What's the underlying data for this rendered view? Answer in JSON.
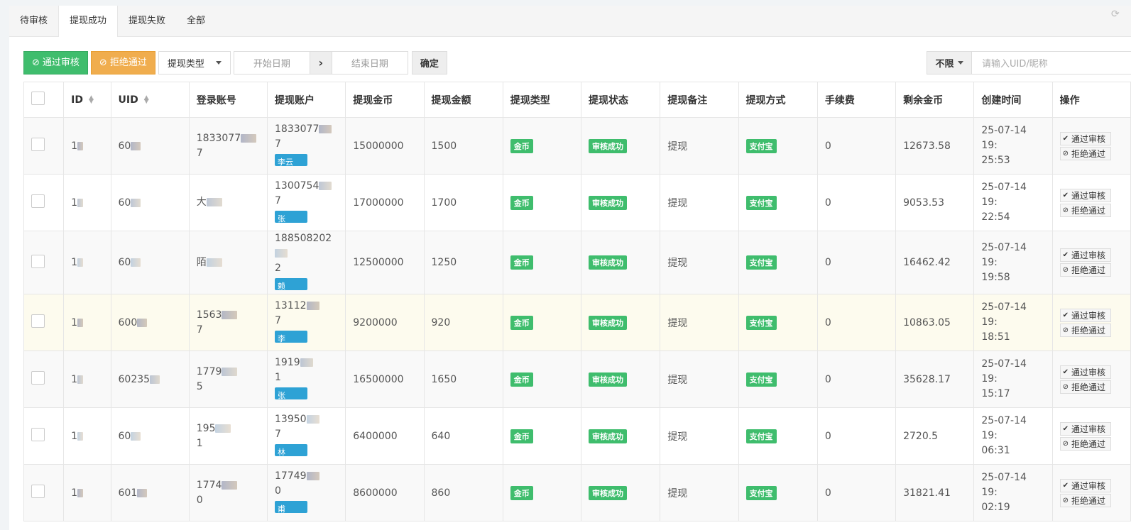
{
  "tabs": [
    {
      "label": "待审核",
      "active": false
    },
    {
      "label": "提现成功",
      "active": true
    },
    {
      "label": "提现失败",
      "active": false
    },
    {
      "label": "全部",
      "active": false
    }
  ],
  "toolbar": {
    "approve_label": "通过审核",
    "reject_label": "拒绝通过",
    "type_select": "提现类型",
    "start_date_placeholder": "开始日期",
    "end_date_placeholder": "结束日期",
    "confirm_label": "确定"
  },
  "search": {
    "filter_value": "不限",
    "placeholder": "请输入UID/昵称"
  },
  "columns": [
    "ID",
    "UID",
    "登录账号",
    "提现账户",
    "提现金币",
    "提现金额",
    "提现类型",
    "提现状态",
    "提现备注",
    "提现方式",
    "手续费",
    "剩余金币",
    "创建时间",
    "操作"
  ],
  "rows": [
    {
      "id": "1",
      "uid": "60",
      "login": [
        "1833077",
        "7"
      ],
      "account": [
        "1833077",
        "7"
      ],
      "name": "李云",
      "coins": "15000000",
      "amount": "1500",
      "type": "金币",
      "status": "审核成功",
      "remark": "提现",
      "method": "支付宝",
      "fee": "0",
      "remain": "12673.58",
      "time": [
        "25-07-14 19:",
        "25:53"
      ]
    },
    {
      "id": "1",
      "uid": "60",
      "login": [
        "大",
        ""
      ],
      "account": [
        "1300754",
        "7"
      ],
      "name": "张",
      "coins": "17000000",
      "amount": "1700",
      "type": "金币",
      "status": "审核成功",
      "remark": "提现",
      "method": "支付宝",
      "fee": "0",
      "remain": "9053.53",
      "time": [
        "25-07-14 19:",
        "22:54"
      ]
    },
    {
      "id": "1",
      "uid": "60",
      "login": [
        "陌",
        ""
      ],
      "account": [
        "188508202",
        "2"
      ],
      "name": "赖",
      "coins": "12500000",
      "amount": "1250",
      "type": "金币",
      "status": "审核成功",
      "remark": "提现",
      "method": "支付宝",
      "fee": "0",
      "remain": "16462.42",
      "time": [
        "25-07-14 19:",
        "19:58"
      ]
    },
    {
      "id": "1",
      "uid": "600",
      "login": [
        "1563",
        "7"
      ],
      "account": [
        "13112",
        "7"
      ],
      "name": "李",
      "coins": "9200000",
      "amount": "920",
      "type": "金币",
      "status": "审核成功",
      "remark": "提现",
      "method": "支付宝",
      "fee": "0",
      "remain": "10863.05",
      "time": [
        "25-07-14 19:",
        "18:51"
      ]
    },
    {
      "id": "1",
      "uid": "60235",
      "login": [
        "1779",
        "5"
      ],
      "account": [
        "1919",
        "1"
      ],
      "name": "张",
      "coins": "16500000",
      "amount": "1650",
      "type": "金币",
      "status": "审核成功",
      "remark": "提现",
      "method": "支付宝",
      "fee": "0",
      "remain": "35628.17",
      "time": [
        "25-07-14 19:",
        "15:17"
      ]
    },
    {
      "id": "1",
      "uid": "60",
      "login": [
        "195",
        "1"
      ],
      "account": [
        "13950",
        "7"
      ],
      "name": "林",
      "coins": "6400000",
      "amount": "640",
      "type": "金币",
      "status": "审核成功",
      "remark": "提现",
      "method": "支付宝",
      "fee": "0",
      "remain": "2720.5",
      "time": [
        "25-07-14 19:",
        "06:31"
      ]
    },
    {
      "id": "1",
      "uid": "601",
      "login": [
        "1774",
        "0"
      ],
      "account": [
        "17749",
        "0"
      ],
      "name": "甫",
      "coins": "8600000",
      "amount": "860",
      "type": "金币",
      "status": "审核成功",
      "remark": "提现",
      "method": "支付宝",
      "fee": "0",
      "remain": "31821.41",
      "time": [
        "25-07-14 19:",
        "02:19"
      ]
    }
  ],
  "row_actions": {
    "approve": "通过审核",
    "reject": "拒绝通过"
  },
  "colors": {
    "success": "#3fbd6d",
    "warning": "#f0ad4e",
    "info": "#2ea2d5"
  }
}
